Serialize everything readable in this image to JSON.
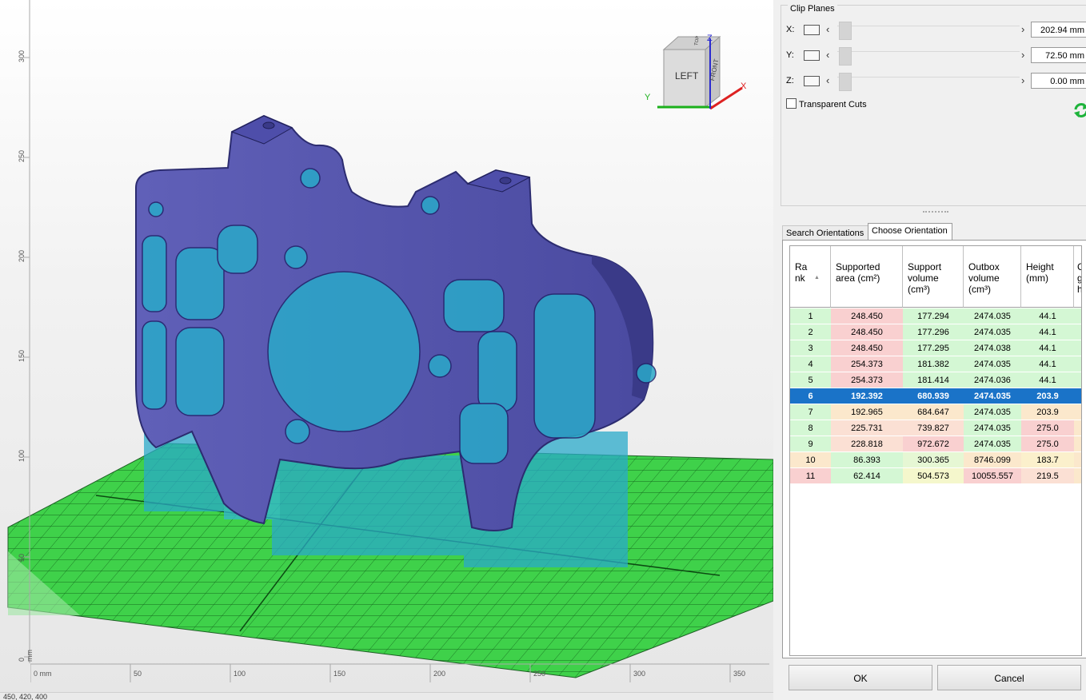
{
  "viewport": {
    "view_cube": {
      "left": "LEFT",
      "front": "FRONT",
      "top": "TOP",
      "axis_x": "X",
      "axis_y": "Y",
      "axis_z": "Z"
    },
    "vertical_ruler": [
      "300",
      "250",
      "200",
      "150",
      "100",
      "50",
      "0 mm"
    ],
    "horizontal_ruler": [
      "0 mm",
      "50",
      "100",
      "150",
      "200",
      "250",
      "300",
      "350"
    ],
    "status_coords": "450, 420, 400"
  },
  "clip_planes": {
    "title": "Clip Planes",
    "rows": [
      {
        "axis": "X:",
        "value": "202.94 mm"
      },
      {
        "axis": "Y:",
        "value": "72.50 mm"
      },
      {
        "axis": "Z:",
        "value": "0.00 mm"
      }
    ],
    "transparent_cuts_label": "Transparent Cuts",
    "transparent_cuts_checked": false
  },
  "tabs": [
    {
      "label": "Search Orientations",
      "active": false
    },
    {
      "label": "Choose Orientation",
      "active": true
    }
  ],
  "table": {
    "headers": [
      "Ra\nnk",
      "Supported\narea (cm²)",
      "Support\nvolume\n(cm³)",
      "Outbox\nvolume\n(cm³)",
      "Height\n(mm)",
      "C\ng\nh"
    ],
    "rows": [
      {
        "rank": "1",
        "area": "248.450",
        "volume": "177.294",
        "outbox": "2474.035",
        "height": "44.1",
        "colors": [
          "#d4f7d4",
          "#f9d0d0",
          "#d4f7d4",
          "#d4f7d4",
          "#d4f7d4",
          "#d4f7d4"
        ]
      },
      {
        "rank": "2",
        "area": "248.450",
        "volume": "177.296",
        "outbox": "2474.035",
        "height": "44.1",
        "colors": [
          "#d4f7d4",
          "#f9d0d0",
          "#d4f7d4",
          "#d4f7d4",
          "#d4f7d4",
          "#d4f7d4"
        ]
      },
      {
        "rank": "3",
        "area": "248.450",
        "volume": "177.295",
        "outbox": "2474.038",
        "height": "44.1",
        "colors": [
          "#d4f7d4",
          "#f9d0d0",
          "#d4f7d4",
          "#d4f7d4",
          "#d4f7d4",
          "#d4f7d4"
        ]
      },
      {
        "rank": "4",
        "area": "254.373",
        "volume": "181.382",
        "outbox": "2474.035",
        "height": "44.1",
        "colors": [
          "#d4f7d4",
          "#f9d0d0",
          "#d4f7d4",
          "#d4f7d4",
          "#d4f7d4",
          "#d4f7d4"
        ]
      },
      {
        "rank": "5",
        "area": "254.373",
        "volume": "181.414",
        "outbox": "2474.036",
        "height": "44.1",
        "colors": [
          "#d4f7d4",
          "#f9d0d0",
          "#d4f7d4",
          "#d4f7d4",
          "#d4f7d4",
          "#d4f7d4"
        ]
      },
      {
        "rank": "6",
        "area": "192.392",
        "volume": "680.939",
        "outbox": "2474.035",
        "height": "203.9",
        "selected": true,
        "colors": [
          "#1a73c8",
          "#1a73c8",
          "#1a73c8",
          "#1a73c8",
          "#1a73c8",
          "#1a73c8"
        ]
      },
      {
        "rank": "7",
        "area": "192.965",
        "volume": "684.647",
        "outbox": "2474.035",
        "height": "203.9",
        "colors": [
          "#d4f7d4",
          "#fbe8cc",
          "#fbe8cc",
          "#d4f7d4",
          "#fbe8cc",
          "#fbe8cc"
        ]
      },
      {
        "rank": "8",
        "area": "225.731",
        "volume": "739.827",
        "outbox": "2474.035",
        "height": "275.0",
        "colors": [
          "#d4f7d4",
          "#fbe0d4",
          "#fbe0d4",
          "#d4f7d4",
          "#f9d0d0",
          "#fbe8cc"
        ]
      },
      {
        "rank": "9",
        "area": "228.818",
        "volume": "972.672",
        "outbox": "2474.035",
        "height": "275.0",
        "colors": [
          "#d4f7d4",
          "#fbe0d4",
          "#f9d0d0",
          "#d4f7d4",
          "#f9d0d0",
          "#fbe8cc"
        ]
      },
      {
        "rank": "10",
        "area": "86.393",
        "volume": "300.365",
        "outbox": "8746.099",
        "height": "183.7",
        "colors": [
          "#fbe8cc",
          "#d4f7d4",
          "#e6f7d4",
          "#fbe8cc",
          "#fbf0cc",
          "#fbe8cc"
        ]
      },
      {
        "rank": "11",
        "area": "62.414",
        "volume": "504.573",
        "outbox": "10055.557",
        "height": "219.5",
        "colors": [
          "#f9d0d0",
          "#d4f7d4",
          "#f5f7cc",
          "#f9d0d0",
          "#fbe0d4",
          "#fbe8cc"
        ]
      }
    ]
  },
  "buttons": {
    "ok": "OK",
    "cancel": "Cancel"
  }
}
